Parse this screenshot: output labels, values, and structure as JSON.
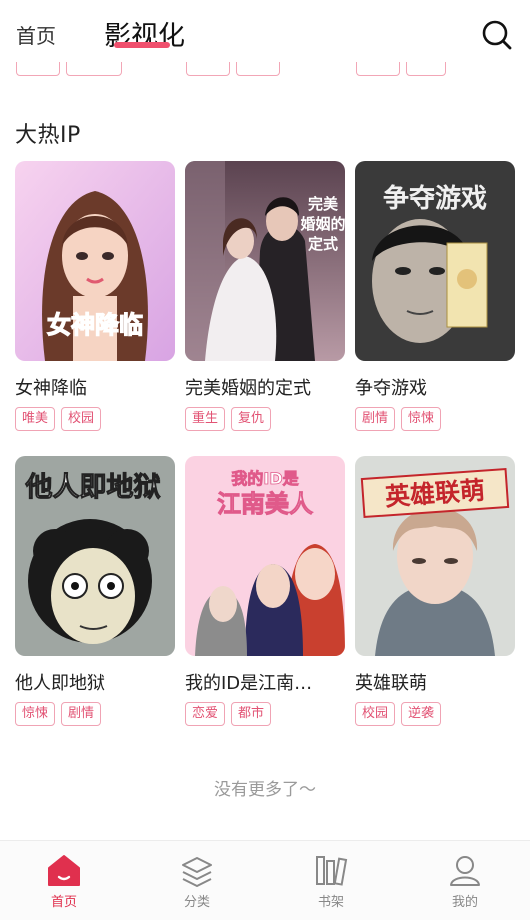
{
  "header": {
    "home_tab": "首页",
    "active_tab": "影视化",
    "search_icon": "search-icon"
  },
  "section": {
    "title": "大热IP"
  },
  "items": [
    {
      "title": "女神降临",
      "cover_text": "女神降临",
      "tags": [
        "唯美",
        "校园"
      ]
    },
    {
      "title": "完美婚姻的定式",
      "cover_text": "完美婚姻的定式",
      "tags": [
        "重生",
        "复仇"
      ]
    },
    {
      "title": "争夺游戏",
      "cover_text": "争夺游戏",
      "tags": [
        "剧情",
        "惊悚"
      ]
    },
    {
      "title": "他人即地狱",
      "cover_text": "他人即地狱",
      "tags": [
        "惊悚",
        "剧情"
      ]
    },
    {
      "title": "我的ID是江南…",
      "cover_text_top": "我的ID是",
      "cover_text_bottom": "江南美人",
      "tags": [
        "恋爱",
        "都市"
      ]
    },
    {
      "title": "英雄联萌",
      "cover_text": "英雄联萌",
      "tags": [
        "校园",
        "逆袭"
      ]
    }
  ],
  "footer_text": "没有更多了～",
  "bottom_nav": [
    {
      "label": "首页",
      "icon": "home-icon",
      "active": true
    },
    {
      "label": "分类",
      "icon": "category-icon",
      "active": false
    },
    {
      "label": "书架",
      "icon": "bookshelf-icon",
      "active": false
    },
    {
      "label": "我的",
      "icon": "profile-icon",
      "active": false
    }
  ],
  "colors": {
    "accent": "#e0304e",
    "tag_text": "#e25374",
    "tag_border": "#f0a3b4",
    "underline": "#f0506e"
  }
}
